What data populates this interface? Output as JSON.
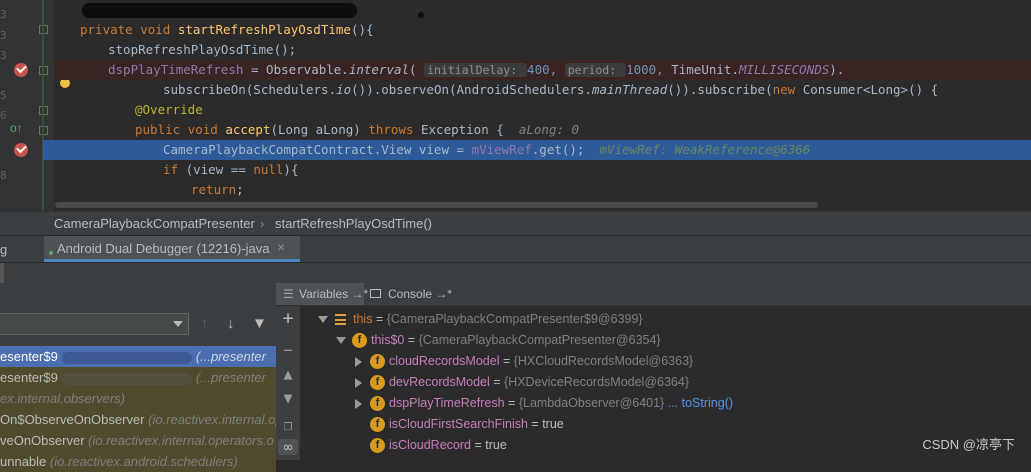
{
  "editor": {
    "lines": [
      {
        "tokens": [
          {
            "t": "private void ",
            "c": "kw"
          },
          {
            "t": "startRefreshPlayOsdTime",
            "c": "fn"
          },
          {
            "t": "(){"
          }
        ]
      },
      {
        "tokens": [
          {
            "t": "stopRefreshPlayOsdTime();"
          }
        ]
      },
      {
        "tokens": [
          {
            "t": "dspPlayTimeRefresh",
            "c": "fld"
          },
          {
            "t": " = Observable."
          },
          {
            "t": "interval",
            "c": "it"
          },
          {
            "t": "( "
          },
          {
            "t": "initialDelay: ",
            "c": "hint"
          },
          {
            "t": "400, ",
            "c": "num"
          },
          {
            "t": "period: ",
            "c": "hint"
          },
          {
            "t": "1000, ",
            "c": "num"
          },
          {
            "t": "TimeUnit."
          },
          {
            "t": "MILLISECONDS",
            "c": "fld it"
          },
          {
            "t": ")."
          }
        ]
      },
      {
        "tokens": [
          {
            "t": "subscribeOn(Schedulers."
          },
          {
            "t": "io",
            "c": "it"
          },
          {
            "t": "()).observeOn(AndroidSchedulers."
          },
          {
            "t": "mainThread",
            "c": "it"
          },
          {
            "t": "()).subscribe("
          },
          {
            "t": "new ",
            "c": "kw"
          },
          {
            "t": "Consumer<Long>() {"
          }
        ]
      },
      {
        "tokens": [
          {
            "t": "@Override",
            "c": "ann"
          }
        ]
      },
      {
        "tokens": [
          {
            "t": "public void ",
            "c": "kw"
          },
          {
            "t": "accept",
            "c": "fn"
          },
          {
            "t": "(Long aLong) "
          },
          {
            "t": "throws ",
            "c": "kw"
          },
          {
            "t": "Exception {  "
          },
          {
            "t": "aLong: 0",
            "c": "gray"
          }
        ]
      },
      {
        "tokens": [
          {
            "t": "CameraPlaybackCompatContract.View view = "
          },
          {
            "t": "mViewRef",
            "c": "fld"
          },
          {
            "t": ".get();  "
          },
          {
            "t": "mViewRef: WeakReference@6366",
            "c": "dbgval"
          }
        ]
      },
      {
        "tokens": [
          {
            "t": "if ",
            "c": "kw"
          },
          {
            "t": "(view == "
          },
          {
            "t": "null",
            "c": "kw"
          },
          {
            "t": "){"
          }
        ]
      },
      {
        "tokens": [
          {
            "t": "return",
            "c": "kw"
          },
          {
            "t": ";"
          }
        ]
      }
    ]
  },
  "breadcrumb": {
    "class_name": "CameraPlaybackCompatPresenter",
    "separator": "›",
    "method_name": "startRefreshPlayOsdTime()"
  },
  "debug_tab": {
    "label": "Android Dual Debugger (12216)-java",
    "close": "×"
  },
  "panel_tabs": {
    "variables": "Variables →*",
    "console": "Console →*"
  },
  "frames": [
    {
      "name": "esenter$9",
      "pkg": "(...presenter",
      "state": "selected"
    },
    {
      "name": "esenter$9",
      "pkg": "(...presenter",
      "state": "yellow"
    },
    {
      "name": "",
      "pkg": "ex.internal.observers)",
      "state": "yellow"
    },
    {
      "name": "On$ObserveOnObserver ",
      "pkg": "(io.reactivex.internal.op",
      "state": "yellow"
    },
    {
      "name": "veOnObserver ",
      "pkg": "(io.reactivex.internal.operators.o",
      "state": "yellow"
    },
    {
      "name": "unnable ",
      "pkg": "(io.reactivex.android.schedulers)",
      "state": "yellow"
    }
  ],
  "variables": [
    {
      "name": "this",
      "value": "{CameraPlaybackCompatPresenter$9@6399}",
      "indent": 0,
      "expand": "down",
      "icon": "list",
      "style": "this"
    },
    {
      "name": "this$0",
      "value": "{CameraPlaybackCompatPresenter@6354}",
      "indent": 1,
      "expand": "down",
      "icon": "f",
      "style": "field"
    },
    {
      "name": "cloudRecordsModel",
      "value": "{HXCloudRecordsModel@6363}",
      "indent": 2,
      "expand": "right",
      "icon": "f",
      "style": "field"
    },
    {
      "name": "devRecordsModel",
      "value": "{HXDeviceRecordsModel@6364}",
      "indent": 2,
      "expand": "right",
      "icon": "f",
      "style": "field"
    },
    {
      "name": "dspPlayTimeRefresh",
      "value": "{LambdaObserver@6401}",
      "link": "... toString()",
      "indent": 2,
      "expand": "right",
      "icon": "f",
      "style": "field"
    },
    {
      "name": "isCloudFirstSearchFinish",
      "value": "true",
      "indent": 2,
      "expand": "none",
      "icon": "f",
      "style": "field",
      "plain": true
    },
    {
      "name": "isCloudRecord",
      "value": "true",
      "indent": 2,
      "expand": "none",
      "icon": "f",
      "style": "field",
      "plain": true
    }
  ],
  "watermark": "CSDN @凉亭下",
  "colors": {
    "selection": "#4b6eaf",
    "current_line": "#2d5b9a",
    "breakpoint": "#c75450",
    "field_icon": "#d99a1d"
  }
}
